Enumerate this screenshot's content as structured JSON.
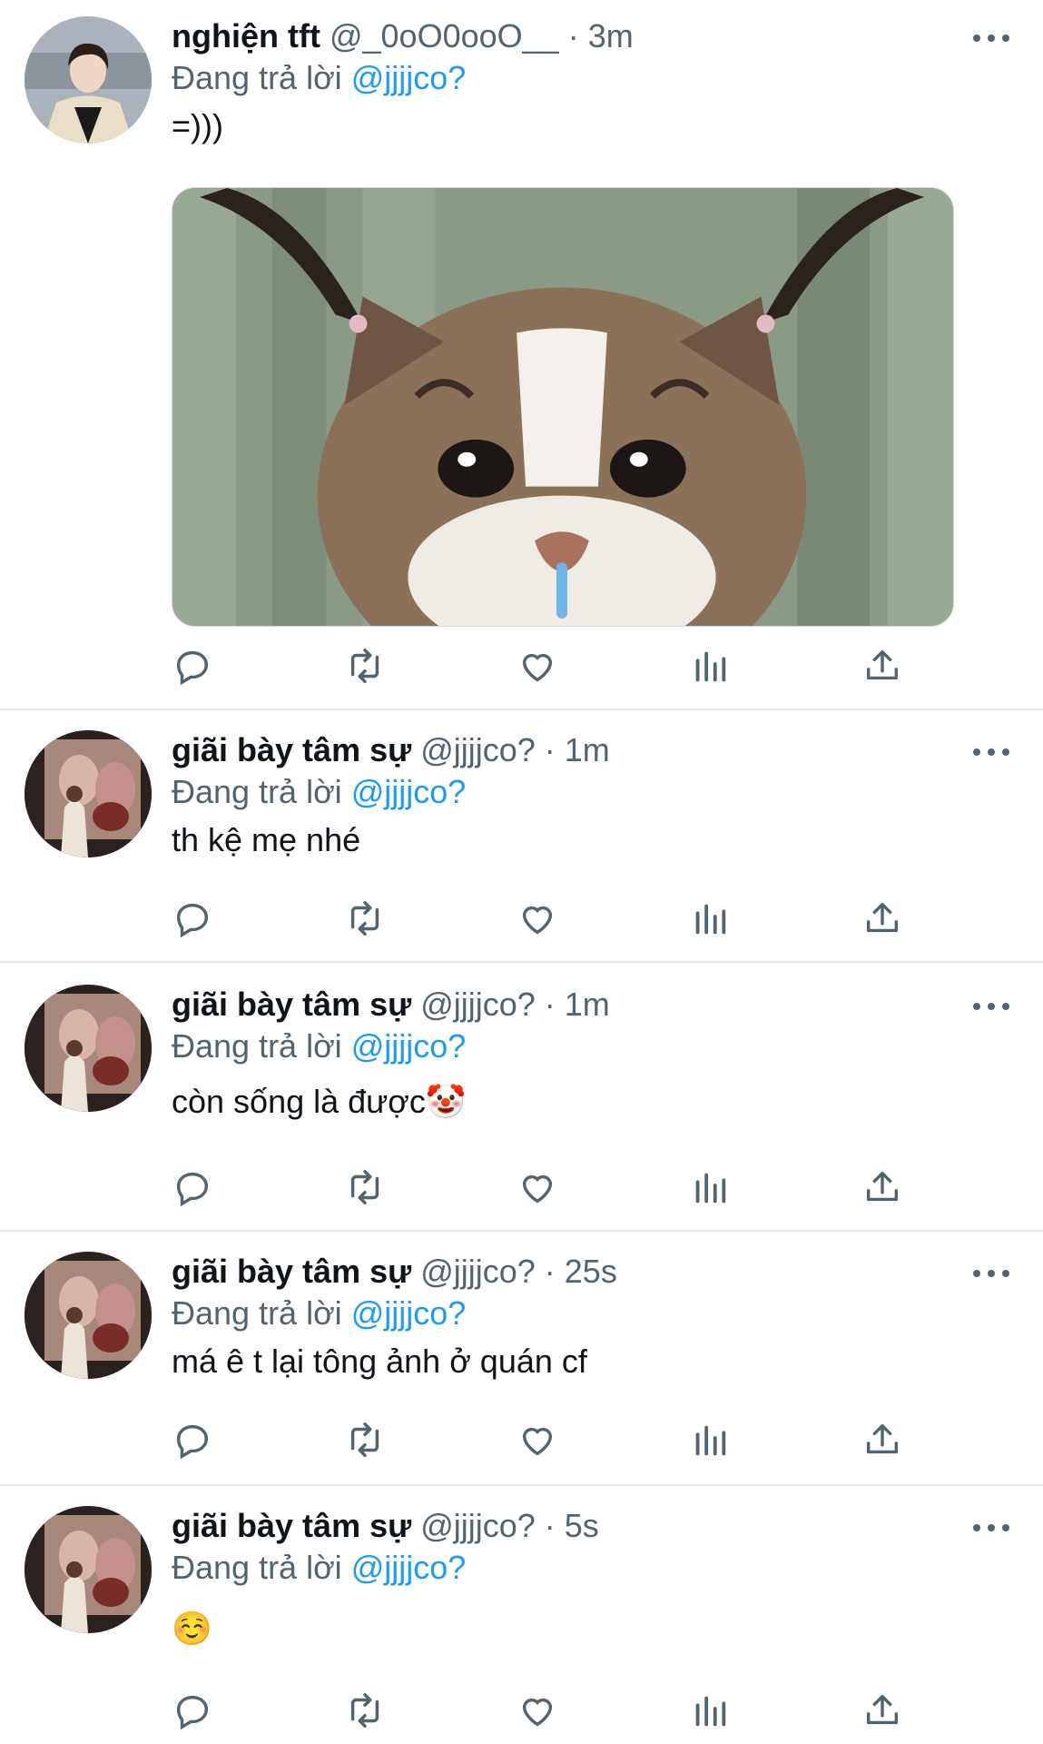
{
  "reply_prefix": "Đang trả lời",
  "colors": {
    "accent": "#1d9bf0",
    "secondary": "#536471",
    "text": "#0f1419",
    "divider": "#e7e9ea"
  },
  "action_icons": [
    "reply-icon",
    "retweet-icon",
    "like-icon",
    "analytics-icon",
    "share-icon"
  ],
  "tweets": [
    {
      "name": "nghiện tft",
      "handle": "@_0oO0ooO__",
      "time": "· 3m",
      "reply_to": "@jjjjco?",
      "text": "=)))",
      "media": "crying-cat-image"
    },
    {
      "name": "giãi bày tâm sự",
      "handle": "@jjjjco?",
      "time": "· 1m",
      "reply_to": "@jjjjco?",
      "text": "th kệ mẹ nhé"
    },
    {
      "name": "giãi bày tâm sự",
      "handle": "@jjjjco?",
      "time": "· 1m",
      "reply_to": "@jjjjco?",
      "text": "còn sống là được🤡"
    },
    {
      "name": "giãi bày tâm sự",
      "handle": "@jjjjco?",
      "time": "· 25s",
      "reply_to": "@jjjjco?",
      "text": "má ê t lại tông ảnh ở quán cf"
    },
    {
      "name": "giãi bày tâm sự",
      "handle": "@jjjjco?",
      "time": "· 5s",
      "reply_to": "@jjjjco?",
      "text": "☺️"
    }
  ]
}
